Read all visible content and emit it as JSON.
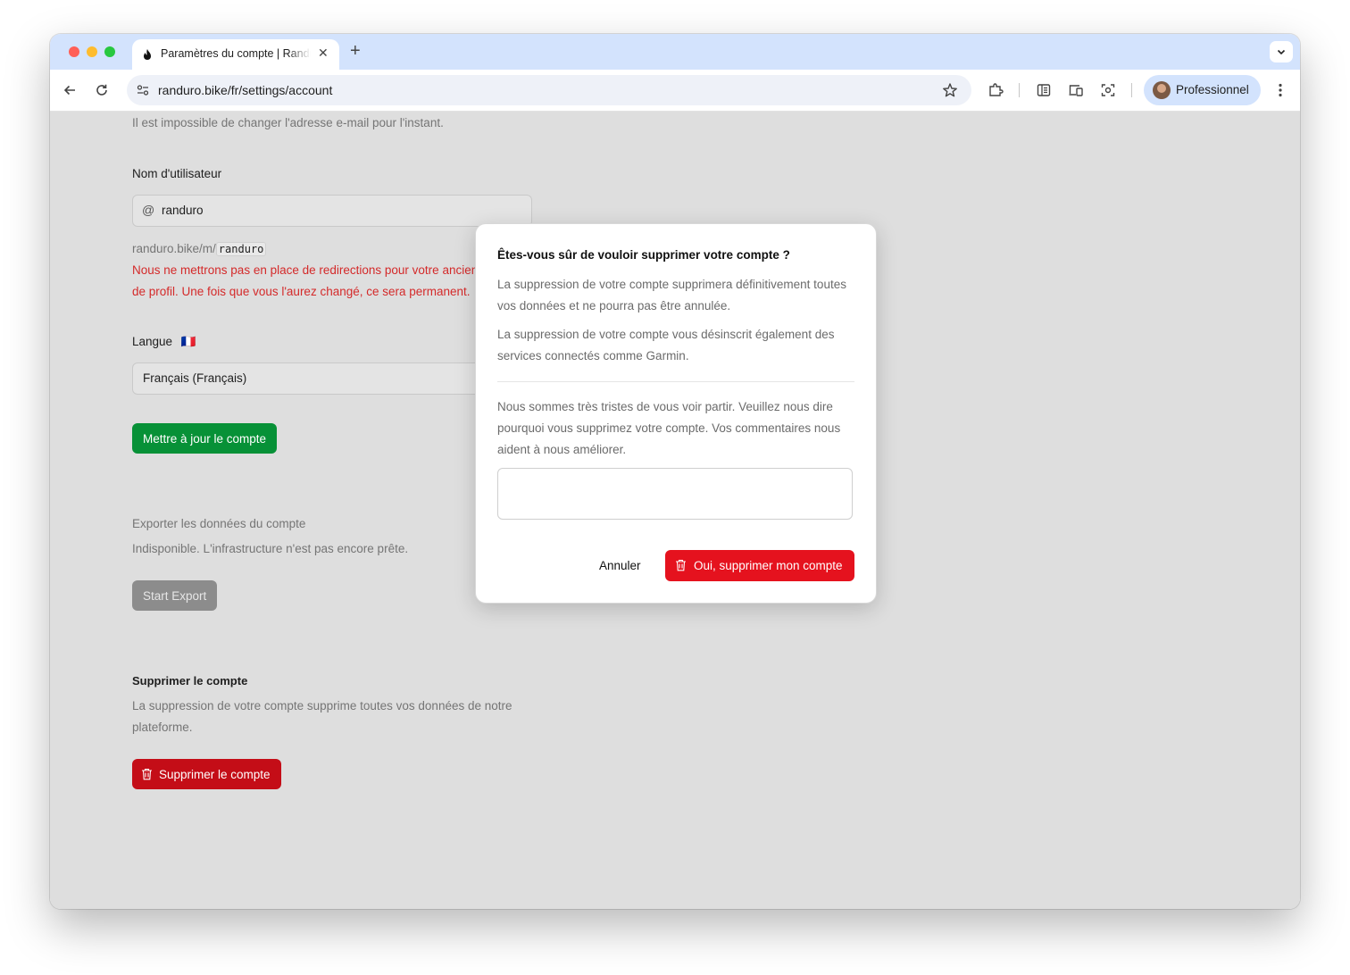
{
  "browser": {
    "tab_title": "Paramètres du compte | Randuro",
    "url": "randuro.bike/fr/settings/account",
    "profile_label": "Professionnel",
    "icons": [
      "flame-favicon-icon",
      "close-icon",
      "plus-icon",
      "chevron-down-icon",
      "back-icon",
      "reload-icon",
      "site-settings-icon",
      "star-icon",
      "extensions-icon",
      "reading-list-icon",
      "device-icon",
      "screenshot-icon",
      "menu-icon"
    ]
  },
  "page": {
    "email_note": "Il est impossible de changer l'adresse e-mail pour l'instant.",
    "username_label": "Nom d'utilisateur",
    "username_value": "randuro",
    "profile_url_prefix": "randuro.bike/m/",
    "profile_url_handle": "randuro",
    "warning_line1": "Nous ne mettrons pas en place de redirections pour votre ancien",
    "warning_line2": "de profil. Une fois que vous l'aurez changé, ce sera permanent.",
    "language_label": "Langue",
    "language_flag": "🇫🇷",
    "language_value": "Français (Français)",
    "update_button": "Mettre à jour le compte",
    "export_heading": "Exporter les données du compte",
    "export_note": "Indisponible. L'infrastructure n'est pas encore prête.",
    "export_button": "Start Export",
    "delete_heading": "Supprimer le compte",
    "delete_note_line1": "La suppression de votre compte supprime toutes vos données de notre",
    "delete_note_line2": "plateforme.",
    "delete_button": "Supprimer le compte"
  },
  "modal": {
    "title": "Êtes-vous sûr de vouloir supprimer votre compte ?",
    "para1": "La suppression de votre compte supprimera définitivement toutes vos données et ne pourra pas être annulée.",
    "para2": "La suppression de votre compte vous désinscrit également des services connectés comme Garmin.",
    "para3": "Nous sommes très tristes de vous voir partir. Veuillez nous dire pourquoi vous supprimez votre compte. Vos commentaires nous aident à nous améliorer.",
    "feedback_value": "",
    "cancel_label": "Annuler",
    "confirm_label": "Oui, supprimer mon compte"
  },
  "colors": {
    "success": "#079137",
    "danger": "#e5121e",
    "danger_dim": "#c40d17",
    "disabled": "#8c8c8c"
  }
}
